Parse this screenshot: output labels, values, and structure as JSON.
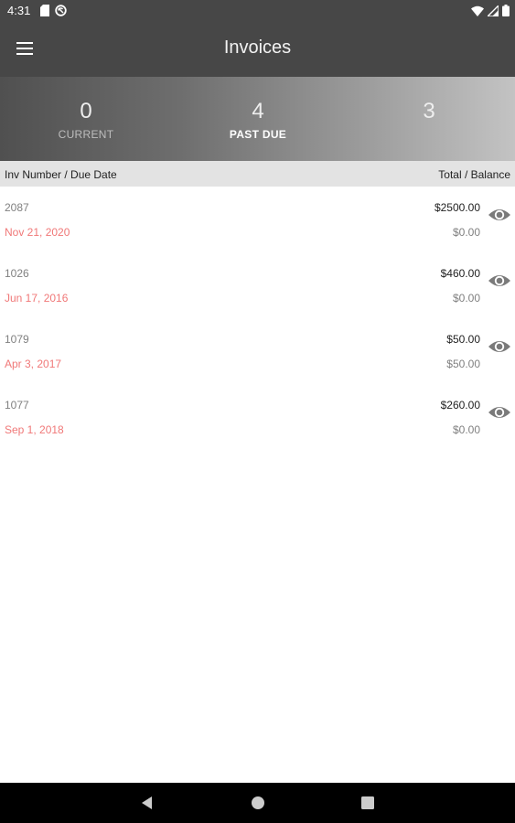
{
  "status_bar": {
    "time": "4:31",
    "left_icons": [
      "sd-card-icon",
      "sync-icon"
    ],
    "right_icons": [
      "wifi-icon",
      "signal-icon",
      "battery-icon"
    ]
  },
  "app_bar": {
    "title": "Invoices",
    "menu_icon": "hamburger-menu-icon"
  },
  "summary": {
    "tabs": [
      {
        "count": "0",
        "label": "CURRENT"
      },
      {
        "count": "4",
        "label": "PAST DUE"
      },
      {
        "count": "3",
        "label": ""
      }
    ],
    "active_tab": "PAST DUE"
  },
  "table": {
    "header_left": "Inv Number / Due Date",
    "header_right": "Total / Balance",
    "rows": [
      {
        "number": "2087",
        "due_date": "Nov 21, 2020",
        "total": "$2500.00",
        "balance": "$0.00"
      },
      {
        "number": "1026",
        "due_date": "Jun 17, 2016",
        "total": "$460.00",
        "balance": "$0.00"
      },
      {
        "number": "1079",
        "due_date": "Apr 3, 2017",
        "total": "$50.00",
        "balance": "$50.00"
      },
      {
        "number": "1077",
        "due_date": "Sep 1, 2018",
        "total": "$260.00",
        "balance": "$0.00"
      }
    ],
    "row_action_icon": "eye-icon"
  },
  "colors": {
    "app_bar": "#474747",
    "due_date": "#f07878",
    "header_background": "#e3e3e3"
  },
  "nav_bar": {
    "icons": [
      "back-icon",
      "home-icon",
      "recents-icon"
    ]
  }
}
